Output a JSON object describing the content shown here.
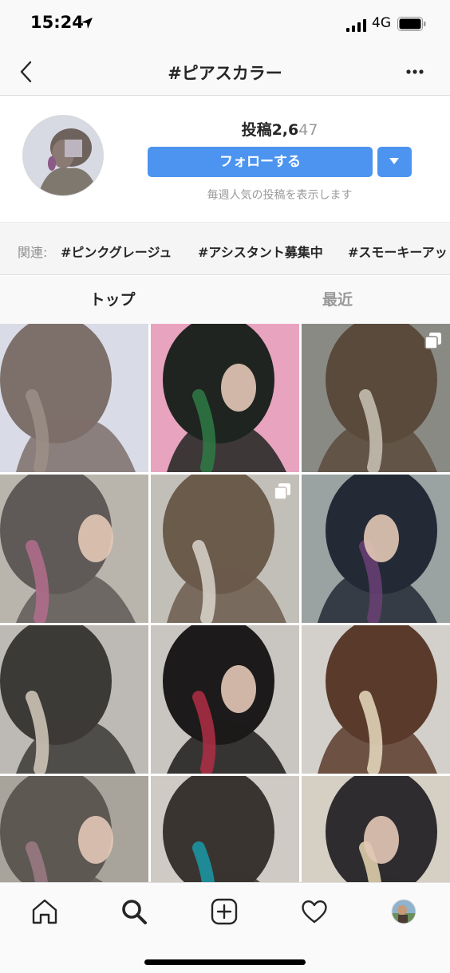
{
  "status_bar": {
    "time": "15:24",
    "network": "4G"
  },
  "nav": {
    "title": "#ピアスカラー"
  },
  "header": {
    "post_label": "投稿",
    "post_count_bold": "2,6",
    "post_count_dim": "47",
    "follow_label": "フォローする",
    "note": "毎週人気の投稿を表示します"
  },
  "related": {
    "label": "関連:",
    "tags": [
      "#ピンクグレージュ",
      "#アシスタント募集中",
      "#スモーキーアッ"
    ]
  },
  "tabs": [
    {
      "label": "トップ",
      "active": true
    },
    {
      "label": "最近",
      "active": false
    }
  ],
  "grid": {
    "tiles": [
      {
        "id": "post-1",
        "colors": [
          "#d9dbe6",
          "#7d6f6a",
          "#9b8f86"
        ],
        "multi": false
      },
      {
        "id": "post-2",
        "colors": [
          "#e8a3bf",
          "#1f2420",
          "#2f7a45"
        ],
        "multi": false
      },
      {
        "id": "post-3",
        "colors": [
          "#8a8a84",
          "#5a4a3c",
          "#c9c3b6"
        ],
        "multi": true
      },
      {
        "id": "post-4",
        "colors": [
          "#b9b5ad",
          "#5f5a57",
          "#b46d8d"
        ],
        "multi": false
      },
      {
        "id": "post-5",
        "colors": [
          "#c2bfb8",
          "#6b5b4b",
          "#d9d5cc"
        ],
        "multi": true
      },
      {
        "id": "post-6",
        "colors": [
          "#9aa2a2",
          "#232a35",
          "#6a3f74"
        ],
        "multi": false
      },
      {
        "id": "post-7",
        "colors": [
          "#bdbab5",
          "#3c3a37",
          "#d5cbbd"
        ],
        "multi": false
      },
      {
        "id": "post-8",
        "colors": [
          "#c9c6c1",
          "#1c1a1a",
          "#b02e45"
        ],
        "multi": false
      },
      {
        "id": "post-9",
        "colors": [
          "#d3d0cb",
          "#5a3b2b",
          "#e8dcc0"
        ],
        "multi": false
      },
      {
        "id": "post-10",
        "colors": [
          "#a8a39b",
          "#5d5852",
          "#9c7a86"
        ],
        "multi": false
      },
      {
        "id": "post-11",
        "colors": [
          "#cfcbc4",
          "#3a3430",
          "#1a9aa8"
        ],
        "multi": false
      },
      {
        "id": "post-12",
        "colors": [
          "#d6cfc4",
          "#2e2c2e",
          "#e6d7b0"
        ],
        "multi": false
      }
    ]
  },
  "tab_bar": {
    "items": [
      "home-icon",
      "search-icon",
      "new-post-icon",
      "activity-icon",
      "profile-icon"
    ]
  },
  "colors": {
    "accent": "#4c94ef"
  }
}
